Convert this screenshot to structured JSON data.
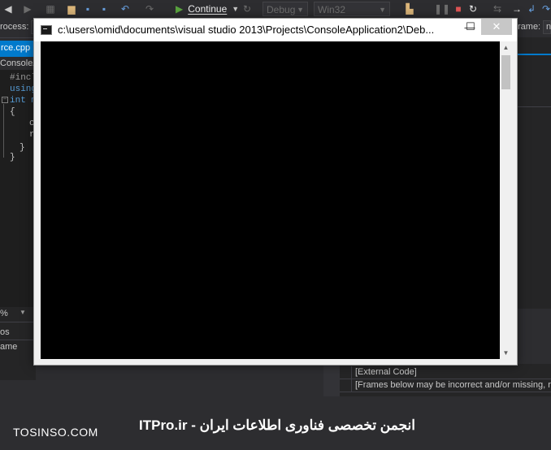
{
  "toolbar": {
    "continue_label": "Continue",
    "config_combo": "Debug",
    "platform_combo": "Win32"
  },
  "strip": {
    "process_label": "rocess:",
    "frame_label": "rame:",
    "frame_value": "n"
  },
  "editor": {
    "tab_label": "rce.cpp",
    "scope_label": "ConsoleA",
    "lines": [
      "#incl",
      "using",
      "int m",
      "{",
      "c",
      "r",
      "}",
      "}"
    ]
  },
  "bottom_left": {
    "zoom_label": "%",
    "row1": "os",
    "row2": "ame"
  },
  "call_stack": {
    "rows": [
      "[External Code]",
      "[Frames below may be incorrect and/or missing, no"
    ]
  },
  "console": {
    "title": "c:\\users\\omid\\documents\\visual studio 2013\\Projects\\ConsoleApplication2\\Deb...",
    "minimize_glyph": "—",
    "maximize_glyph": "☐",
    "close_glyph": "✕"
  },
  "watermark": {
    "left": "TOSINSO.COM",
    "right": "ITPro.ir - انجمن تخصصی فناوری اطلاعات ایران"
  }
}
